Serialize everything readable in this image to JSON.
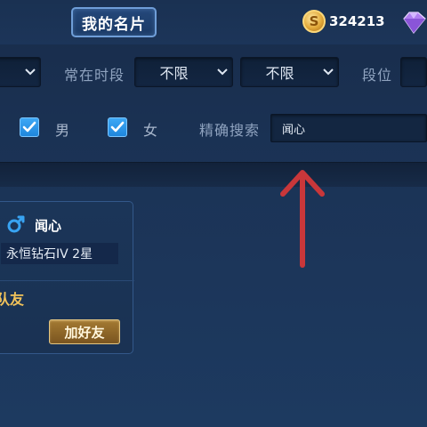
{
  "header": {
    "title_tab": "我的名片",
    "coins": "324213",
    "coin_icon": "gold-coin-icon",
    "gem_icon": "purple-diamond-icon"
  },
  "filters": {
    "first_select_value": "",
    "active_time_label": "常在时段",
    "active_time_start": "不限",
    "active_time_end": "不限",
    "rank_label": "段位",
    "rank_value": ""
  },
  "options": {
    "male_label": "男",
    "male_checked": true,
    "female_label": "女",
    "female_checked": true,
    "precise_search_label": "精确搜索",
    "precise_search_value": "闻心"
  },
  "annotation": {
    "arrow_color": "#c9373a",
    "arrow_direction": "up"
  },
  "card": {
    "gender_icon": "male-icon",
    "name": "闻心",
    "rank": "永恒钻石IV 2星",
    "team_tag": "队友",
    "add_friend_label": "加好友"
  },
  "colors": {
    "accent_blue": "#2f95e8",
    "gold": "#f0c25a"
  }
}
